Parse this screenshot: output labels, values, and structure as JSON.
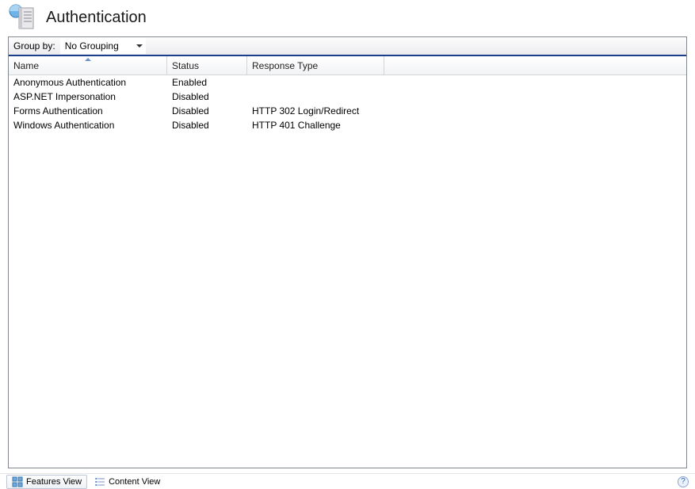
{
  "header": {
    "title": "Authentication"
  },
  "toolbar": {
    "group_label": "Group by:",
    "group_value": "No Grouping"
  },
  "grid": {
    "columns": {
      "name": "Name",
      "status": "Status",
      "response": "Response Type"
    },
    "rows": [
      {
        "name": "Anonymous Authentication",
        "status": "Enabled",
        "response": ""
      },
      {
        "name": "ASP.NET Impersonation",
        "status": "Disabled",
        "response": ""
      },
      {
        "name": "Forms Authentication",
        "status": "Disabled",
        "response": "HTTP 302 Login/Redirect"
      },
      {
        "name": "Windows Authentication",
        "status": "Disabled",
        "response": "HTTP 401 Challenge"
      }
    ]
  },
  "footer": {
    "features_view": "Features View",
    "content_view": "Content View"
  }
}
